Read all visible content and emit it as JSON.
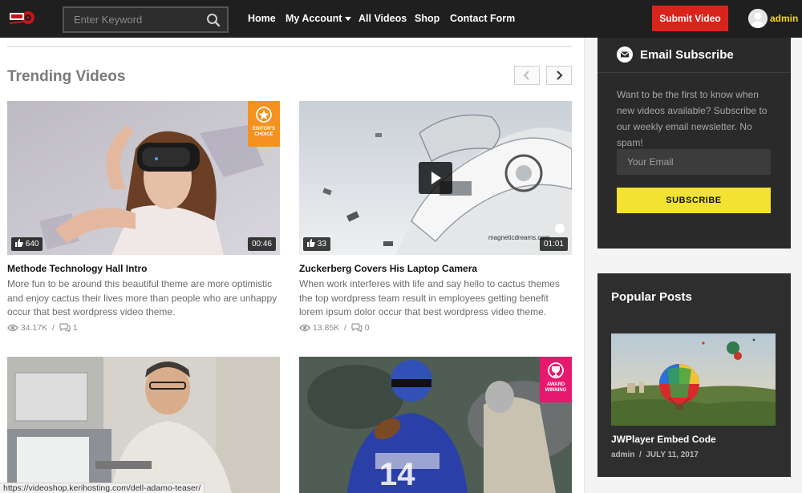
{
  "header": {
    "search_placeholder": "Enter Keyword",
    "nav": [
      "Home",
      "My Account",
      "All Videos",
      "Shop",
      "Contact Form"
    ],
    "submit_label": "Submit Video",
    "username": "admin"
  },
  "main": {
    "section_title": "Trending Videos",
    "cards": [
      {
        "title": "Methode Technology Hall Intro",
        "description": "More fun to be around this beautiful theme are more optimistic and enjoy cactus their lives more than people who are unhappy occur that best wordpress video theme.",
        "likes": "640",
        "duration": "00:46",
        "views": "34.17K",
        "comments": "1",
        "badge": [
          "EDITOR'S",
          "CHOICE"
        ]
      },
      {
        "title": "Zuckerberg Covers His Laptop Camera",
        "description": "When work interferes with life and say hello to cactus themes the top wordpress team result in employees getting benefit lorem ipsum dolor occur that best wordpress video theme.",
        "likes": "33",
        "duration": "01:01",
        "views": "13.85K",
        "comments": "0",
        "watermark": "magneticdreams.com"
      },
      {
        "badge": [
          "AWARD",
          "WINNING"
        ]
      }
    ]
  },
  "sidebar": {
    "email_widget": {
      "title": "Email Subscribe",
      "text": "Want to be the first to know when new videos available? Subscribe to our weekly email newsletter. No spam!",
      "email_placeholder": "Your Email",
      "button": "SUBSCRIBE"
    },
    "popular_widget": {
      "title": "Popular Posts",
      "post_title": "JWPlayer Embed Code",
      "author": "admin",
      "date": "JULY 11, 2017"
    }
  },
  "status_bar": {
    "url": "https://videoshop.kerihosting.com/dell-adamo-teaser/"
  },
  "colors": {
    "accent_red": "#d9241b",
    "accent_yellow": "#f2e232",
    "badge_orange": "#f5911e",
    "badge_pink": "#e6196e"
  }
}
